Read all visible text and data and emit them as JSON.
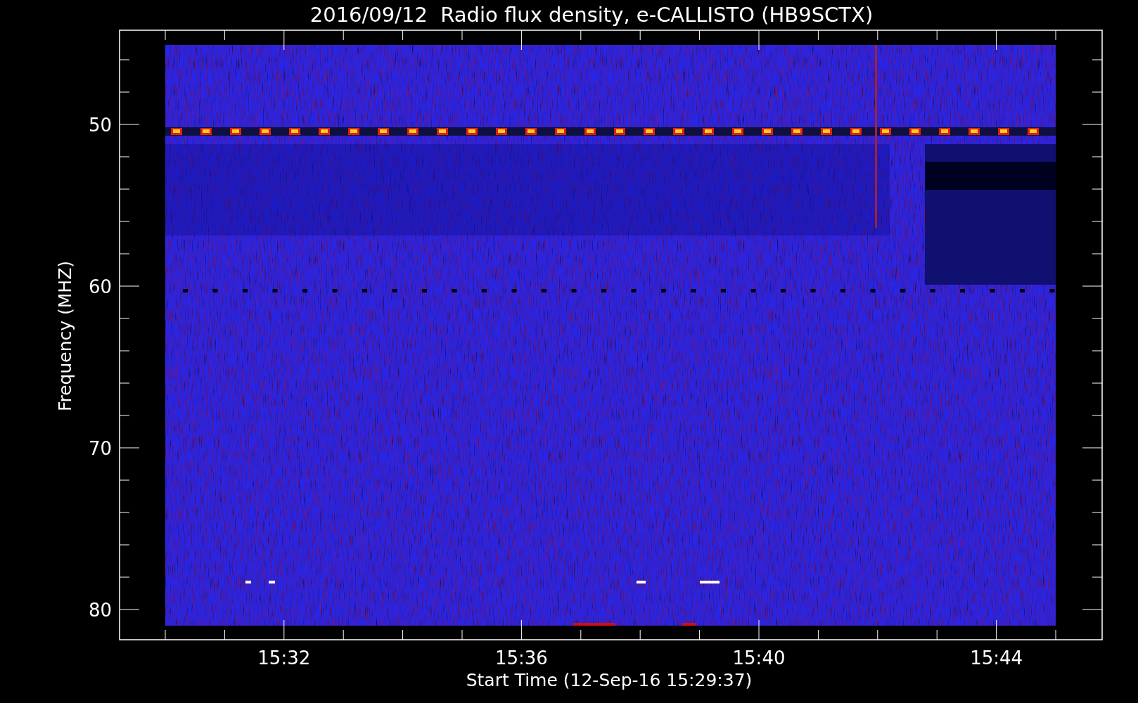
{
  "title": "2016/09/12  Radio flux density, e-CALLISTO (HB9SCTX)",
  "y_axis": {
    "label": "Frequency (MHZ)",
    "ticks": [
      "50",
      "60",
      "70",
      "80"
    ]
  },
  "x_axis": {
    "label": "Start Time (12-Sep-16 15:29:37)",
    "ticks": [
      "15:32",
      "15:36",
      "15:40",
      "15:44"
    ]
  }
}
